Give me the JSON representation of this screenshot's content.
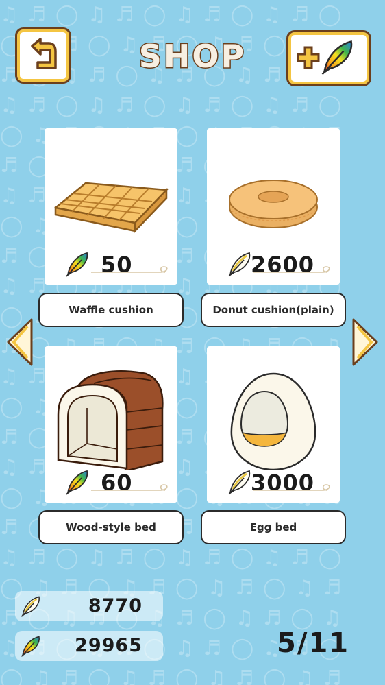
{
  "header": {
    "title": "SHOP",
    "back_icon": "back-arrow-icon",
    "add_feather_icon": "plus-rainbow-feather-icon"
  },
  "items": [
    {
      "name": "Waffle cushion",
      "price": "50",
      "currency_icon": "rainbow-feather-icon"
    },
    {
      "name": "Donut cushion(plain)",
      "price": "2600",
      "currency_icon": "white-feather-icon"
    },
    {
      "name": "Wood-style bed",
      "price": "60",
      "currency_icon": "rainbow-feather-icon"
    },
    {
      "name": "Egg bed",
      "price": "3000",
      "currency_icon": "white-feather-icon"
    }
  ],
  "balances": {
    "white_feathers": "8770",
    "rainbow_feathers": "29965"
  },
  "pagination": {
    "indicator": "5/11"
  },
  "colors": {
    "background": "#8fd0ea",
    "title_outline": "#6b3f1d",
    "button_accent": "#f4c542"
  }
}
